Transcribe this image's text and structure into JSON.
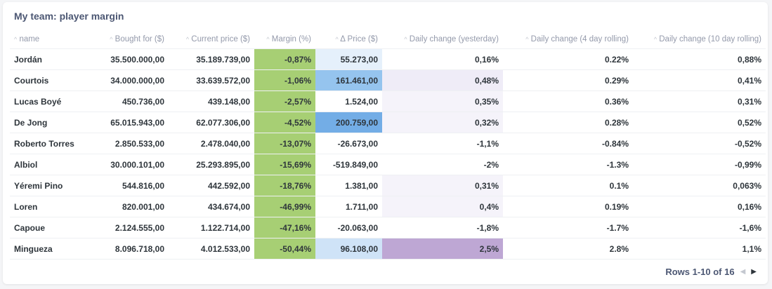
{
  "card": {
    "title": "My team: player margin"
  },
  "colors": {
    "margin_bg": "#a7cf74",
    "delta_dark": "#73ade6",
    "delta_mid": "#95c4ee",
    "delta_light": "#cfe3f7",
    "delta_faint": "#e5f0fb",
    "daily_strong": "#bea7d4",
    "daily_light": "#efecf7",
    "daily_faint": "#f5f3fa"
  },
  "columns": [
    {
      "label": "name",
      "align": "left",
      "width": 112
    },
    {
      "label": "Bought for ($)",
      "align": "right",
      "width": 114
    },
    {
      "label": "Current price ($)",
      "align": "right",
      "width": 122
    },
    {
      "label": "Margin (%)",
      "align": "right",
      "width": 87
    },
    {
      "label": "Δ Price ($)",
      "align": "right",
      "width": 95
    },
    {
      "label": "Daily change (yesterday)",
      "align": "right",
      "width": 172
    },
    {
      "label": "Daily change (4 day rolling)",
      "align": "right",
      "width": 185
    },
    {
      "label": "Daily change (10 day rolling)",
      "align": "right",
      "width": 189
    }
  ],
  "rows": [
    {
      "cells": [
        "Jordán",
        "35.500.000,00",
        "35.189.739,00",
        "-0,87%",
        "55.273,00",
        "0,16%",
        "0.22%",
        "0,88%"
      ],
      "delta_level": "faint",
      "daily_level": "none"
    },
    {
      "cells": [
        "Courtois",
        "34.000.000,00",
        "33.639.572,00",
        "-1,06%",
        "161.461,00",
        "0,48%",
        "0.29%",
        "0,41%"
      ],
      "delta_level": "mid",
      "daily_level": "light"
    },
    {
      "cells": [
        "Lucas Boyé",
        "450.736,00",
        "439.148,00",
        "-2,57%",
        "1.524,00",
        "0,35%",
        "0.36%",
        "0,31%"
      ],
      "delta_level": "none",
      "daily_level": "faint"
    },
    {
      "cells": [
        "De Jong",
        "65.015.943,00",
        "62.077.306,00",
        "-4,52%",
        "200.759,00",
        "0,32%",
        "0.28%",
        "0,52%"
      ],
      "delta_level": "dark",
      "daily_level": "faint"
    },
    {
      "cells": [
        "Roberto Torres",
        "2.850.533,00",
        "2.478.040,00",
        "-13,07%",
        "-26.673,00",
        "-1,1%",
        "-0.84%",
        "-0,52%"
      ],
      "delta_level": "none",
      "daily_level": "none"
    },
    {
      "cells": [
        "Albiol",
        "30.000.101,00",
        "25.293.895,00",
        "-15,69%",
        "-519.849,00",
        "-2%",
        "-1.3%",
        "-0,99%"
      ],
      "delta_level": "none",
      "daily_level": "none"
    },
    {
      "cells": [
        "Yéremi Pino",
        "544.816,00",
        "442.592,00",
        "-18,76%",
        "1.381,00",
        "0,31%",
        "0.1%",
        "0,063%"
      ],
      "delta_level": "none",
      "daily_level": "faint"
    },
    {
      "cells": [
        "Loren",
        "820.001,00",
        "434.674,00",
        "-46,99%",
        "1.711,00",
        "0,4%",
        "0.19%",
        "0,16%"
      ],
      "delta_level": "none",
      "daily_level": "faint"
    },
    {
      "cells": [
        "Capoue",
        "2.124.555,00",
        "1.122.714,00",
        "-47,16%",
        "-20.063,00",
        "-1,8%",
        "-1.7%",
        "-1,6%"
      ],
      "delta_level": "none",
      "daily_level": "none"
    },
    {
      "cells": [
        "Mingueza",
        "8.096.718,00",
        "4.012.533,00",
        "-50,44%",
        "96.108,00",
        "2,5%",
        "2.8%",
        "1,1%"
      ],
      "delta_level": "light",
      "daily_level": "strong"
    }
  ],
  "footer": {
    "rows_label": "Rows 1-10 of 16"
  }
}
